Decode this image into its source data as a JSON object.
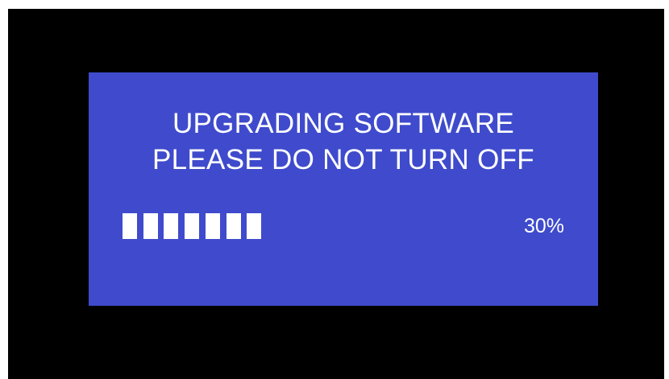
{
  "colors": {
    "background": "#000000",
    "panel": "#3f4bcc",
    "text": "#ffffff"
  },
  "upgrade": {
    "line1": "UPGRADING SOFTWARE",
    "line2": "PLEASE DO NOT TURN OFF",
    "progress_percent_label": "30%",
    "progress_fraction": 0.3,
    "filled_blocks": 7
  }
}
